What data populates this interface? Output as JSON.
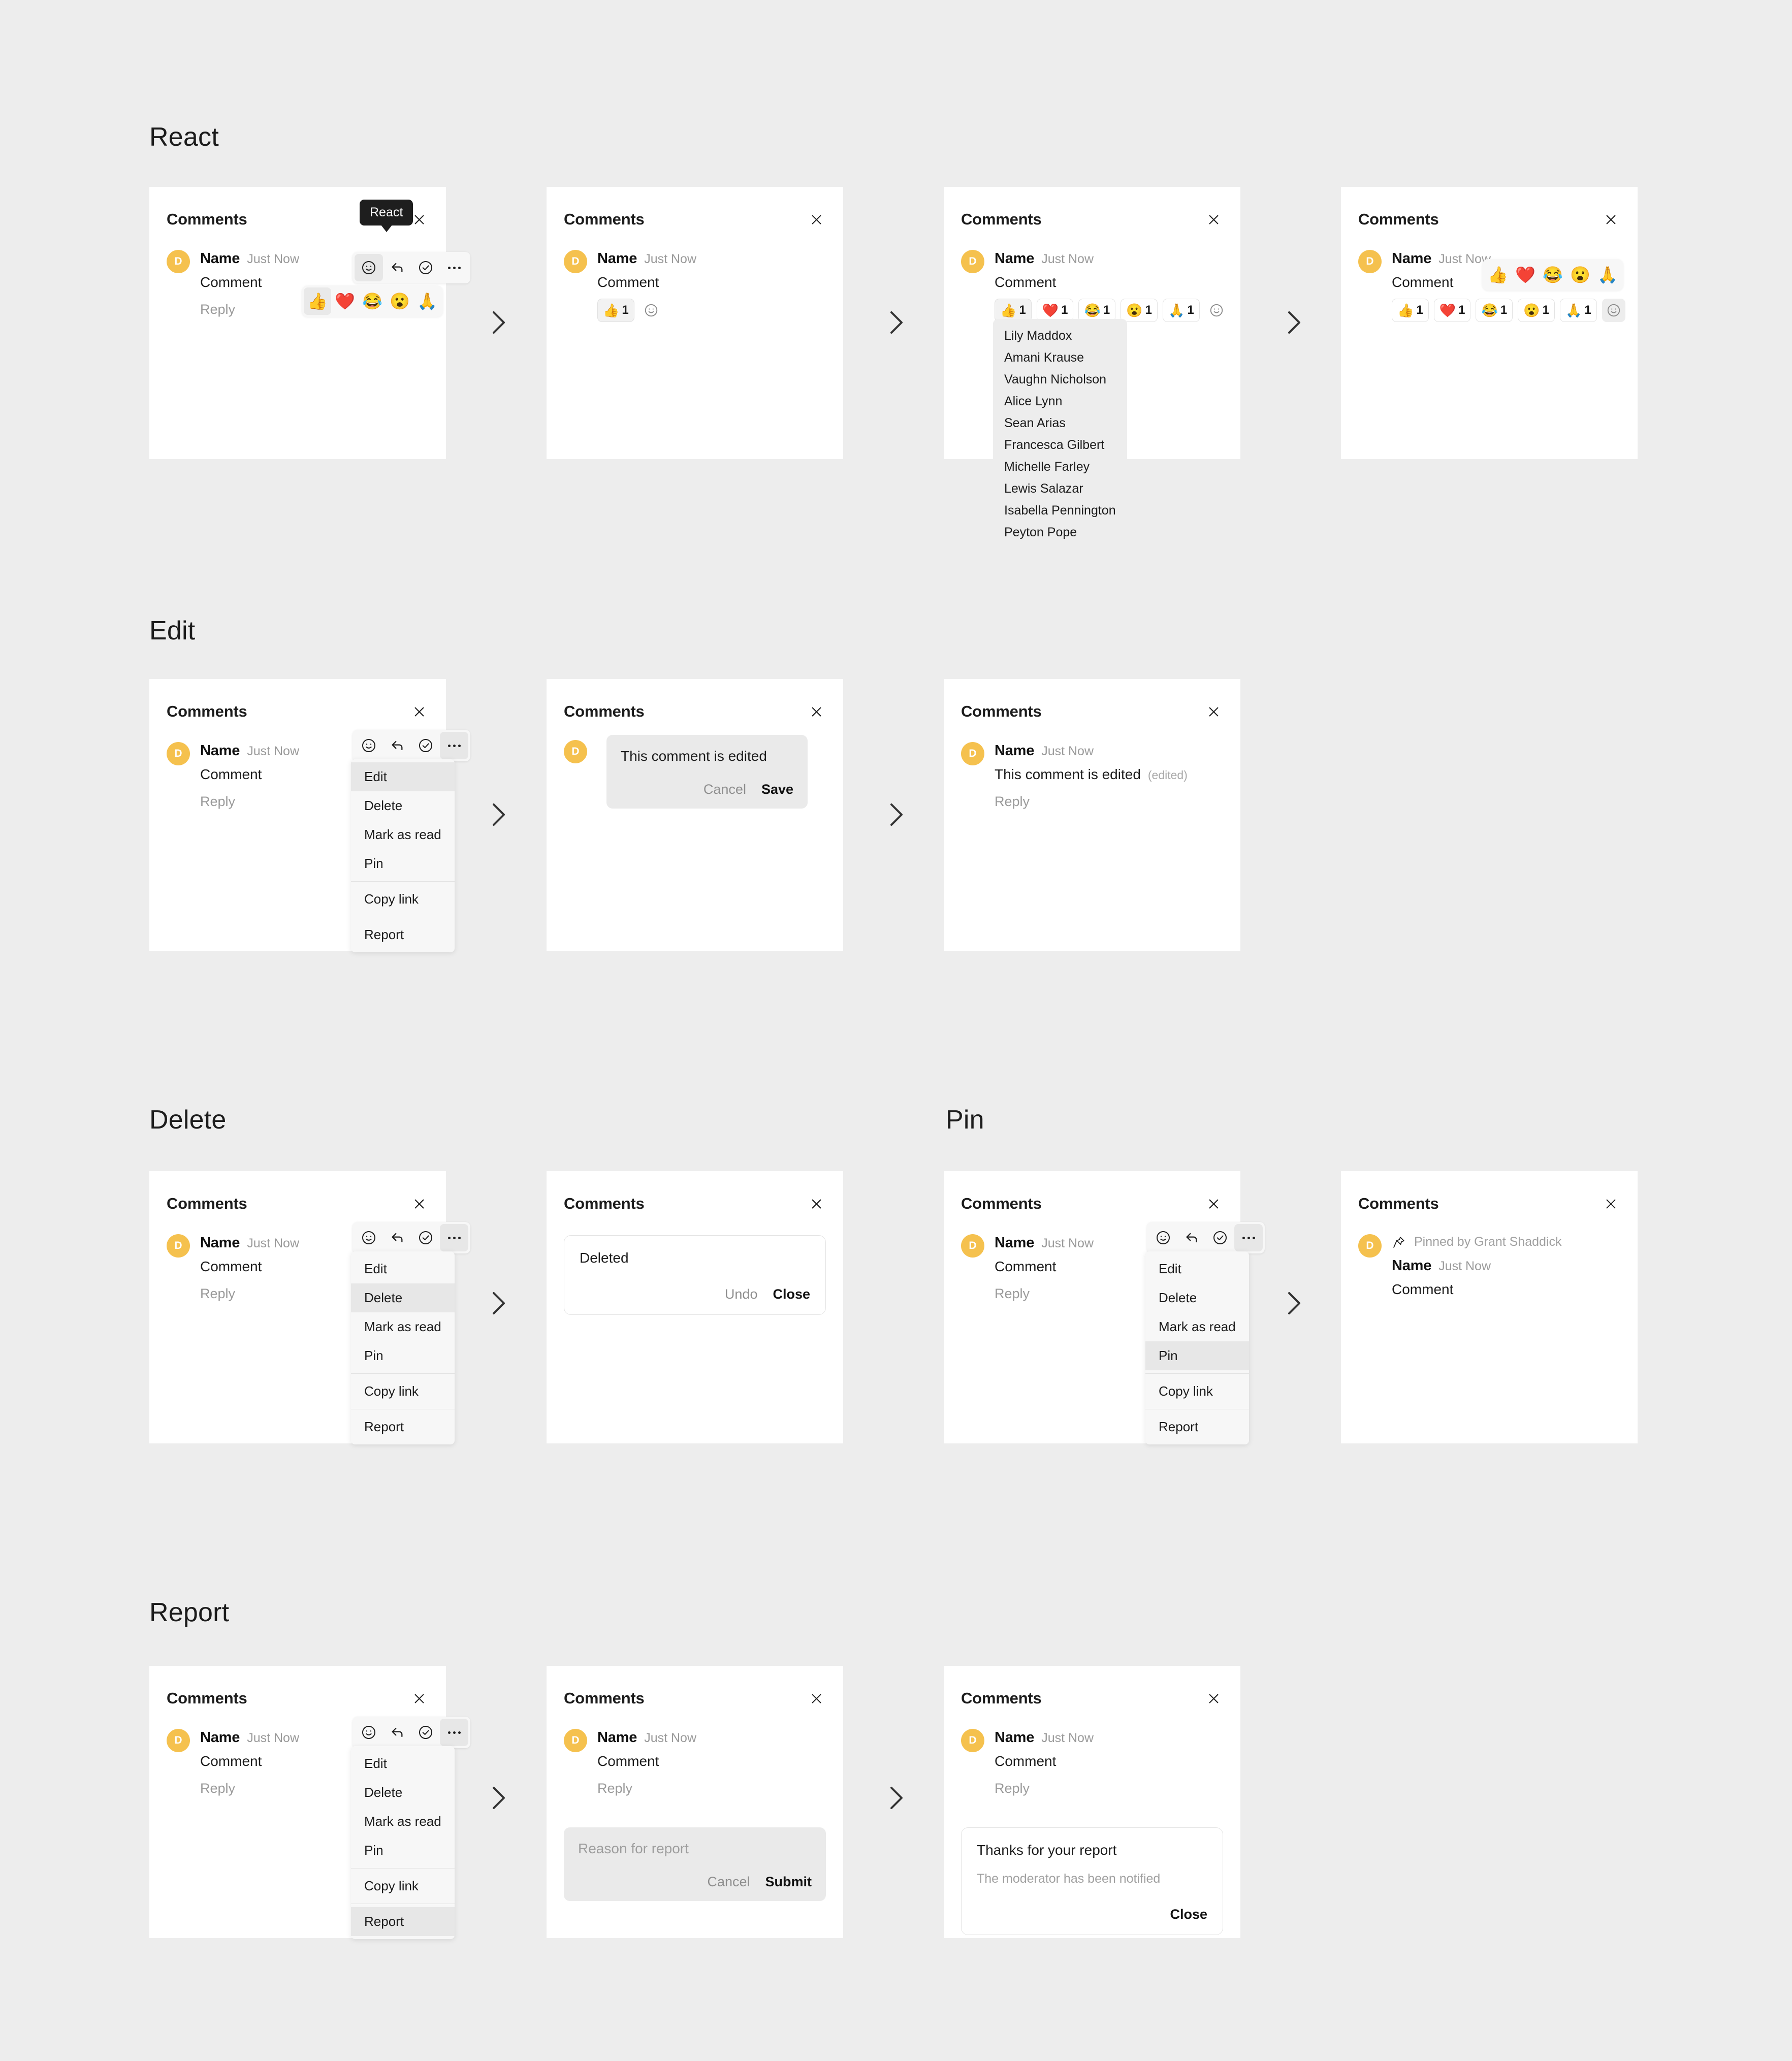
{
  "sections": [
    {
      "id": "react",
      "title": "React"
    },
    {
      "id": "edit",
      "title": "Edit"
    },
    {
      "id": "delete",
      "title": "Delete"
    },
    {
      "id": "pin",
      "title": "Pin"
    },
    {
      "id": "report",
      "title": "Report"
    }
  ],
  "panel": {
    "title": "Comments",
    "close_icon": "close-icon"
  },
  "comment": {
    "avatar_initial": "D",
    "avatar_color": "#F5C14E",
    "author": "Name",
    "timestamp": "Just Now",
    "text": "Comment",
    "reply_label": "Reply",
    "edited_text": "This comment is edited",
    "edited_tag": "(edited)",
    "pinned_by": "Pinned by Grant Shaddick"
  },
  "toolbar": {
    "react_icon": "smiley-icon",
    "reply_icon": "reply-arrow-icon",
    "resolve_icon": "check-circle-icon",
    "more_icon": "more-dots-icon",
    "react_tooltip": "React"
  },
  "emoji_picker": {
    "emojis": [
      "👍",
      "❤️",
      "😂",
      "😮",
      "🙏"
    ]
  },
  "reactions": {
    "single": [
      {
        "emoji": "👍",
        "count": "1",
        "selected": true
      }
    ],
    "full": [
      {
        "emoji": "👍",
        "count": "1",
        "selected": true
      },
      {
        "emoji": "❤️",
        "count": "1",
        "selected": false
      },
      {
        "emoji": "😂",
        "count": "1",
        "selected": false
      },
      {
        "emoji": "😮",
        "count": "1",
        "selected": false
      },
      {
        "emoji": "🙏",
        "count": "1",
        "selected": false
      }
    ],
    "add_icon": "add-reaction-smiley-icon"
  },
  "reactor_names": [
    "Lily Maddox",
    "Amani Krause",
    "Vaughn Nicholson",
    "Alice Lynn",
    "Sean Arias",
    "Francesca Gilbert",
    "Michelle Farley",
    "Lewis Salazar",
    "Isabella Pennington",
    "Peyton Pope"
  ],
  "context_menu": {
    "items": [
      "Edit",
      "Delete",
      "Mark as read",
      "Pin",
      "Copy link",
      "Report"
    ],
    "separators_after": [
      3,
      4
    ]
  },
  "edit_form": {
    "value": "This comment is edited",
    "cancel_label": "Cancel",
    "save_label": "Save"
  },
  "deleted_panel": {
    "title": "Deleted",
    "undo_label": "Undo",
    "close_label": "Close"
  },
  "report_form": {
    "placeholder": "Reason for report",
    "cancel_label": "Cancel",
    "submit_label": "Submit"
  },
  "report_thanks": {
    "title": "Thanks for your report",
    "subtitle": "The moderator has been notified",
    "close_label": "Close"
  }
}
